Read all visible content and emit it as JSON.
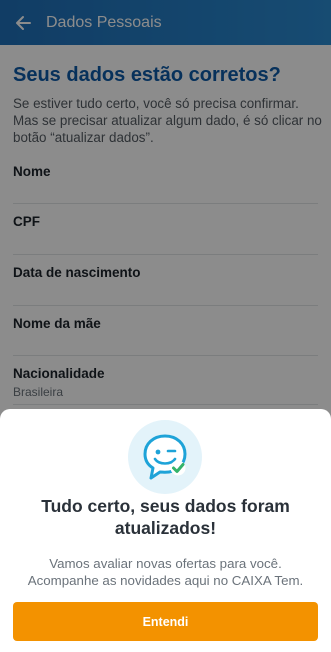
{
  "header": {
    "back_icon": "arrow-left-icon",
    "title": "Dados Pessoais"
  },
  "main": {
    "heading": "Seus dados estão corretos?",
    "intro": "Se estiver tudo certo, você só precisa confirmar. Mas se precisar atualizar algum dado, é só clicar no botão “atualizar dados”.",
    "fields": [
      {
        "label": "Nome",
        "value": ""
      },
      {
        "label": "CPF",
        "value": ""
      },
      {
        "label": "Data de nascimento",
        "value": ""
      },
      {
        "label": "Nome da mãe",
        "value": ""
      },
      {
        "label": "Nacionalidade",
        "value": "Brasileira"
      }
    ]
  },
  "modal": {
    "icon": "smiley-chat-check-icon",
    "title": "Tudo certo, seus dados foram atualizados!",
    "body": "Vamos avaliar novas ofertas para você. Acompanhe as novidades aqui no CAIXA Tem.",
    "button_label": "Entendi"
  },
  "colors": {
    "header": "#1f6fb8",
    "heading": "#0d5aa7",
    "button": "#f39200",
    "icon_bg": "#e3f3fa",
    "icon_accent": "#1ea3d8",
    "check": "#34b36b"
  }
}
